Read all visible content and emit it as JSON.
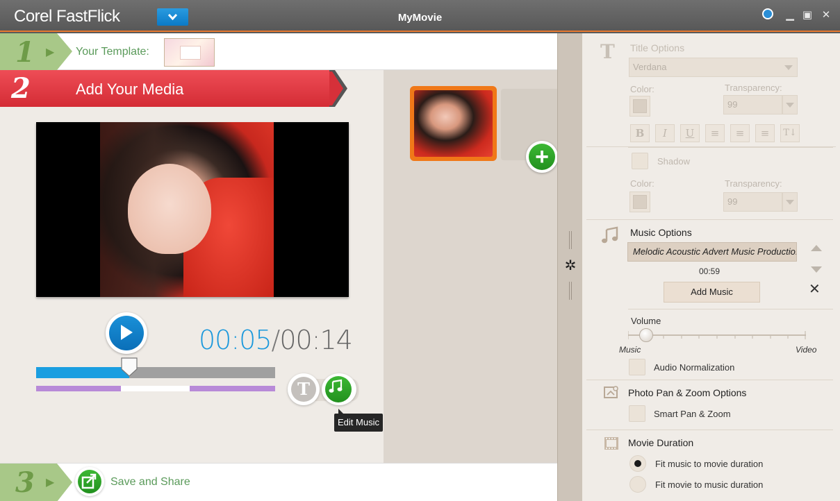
{
  "window": {
    "app_name": "Corel FastFlick",
    "title": "MyMovie",
    "accent_color": "#e8782e"
  },
  "step1": {
    "number": "1",
    "label": "Your Template:"
  },
  "step2": {
    "number": "2",
    "label": "Add Your Media"
  },
  "step3": {
    "number": "3",
    "label": "Save and Share"
  },
  "player": {
    "current_time": "00:05",
    "separator": "/",
    "total_time": "00:14",
    "progress_fraction": 0.39
  },
  "tools": {
    "title_tool_glyph": "T",
    "tooltip": "Edit Music"
  },
  "title_options": {
    "heading": "Title Options",
    "font": "Verdana",
    "color_label": "Color:",
    "transparency_label": "Transparency:",
    "transparency_value": "99",
    "shadow_label": "Shadow",
    "shadow_color_label": "Color:",
    "shadow_transparency_label": "Transparency:",
    "shadow_transparency_value": "99",
    "format_buttons": [
      "B",
      "I",
      "U",
      "≡",
      "≡",
      "≡",
      "T↓"
    ]
  },
  "music_options": {
    "heading": "Music Options",
    "track": "Melodic Acoustic Advert Music Productio...",
    "duration": "00:59",
    "add_button": "Add Music",
    "volume_label": "Volume",
    "volume_left": "Music",
    "volume_right": "Video",
    "volume_fraction": 0.1,
    "normalization_label": "Audio Normalization"
  },
  "pan_zoom": {
    "heading": "Photo Pan & Zoom Options",
    "smart_label": "Smart Pan & Zoom"
  },
  "duration": {
    "heading": "Movie Duration",
    "option_fit_music": "Fit music to movie duration",
    "option_fit_movie": "Fit movie to music duration",
    "selected": "fit_music"
  }
}
